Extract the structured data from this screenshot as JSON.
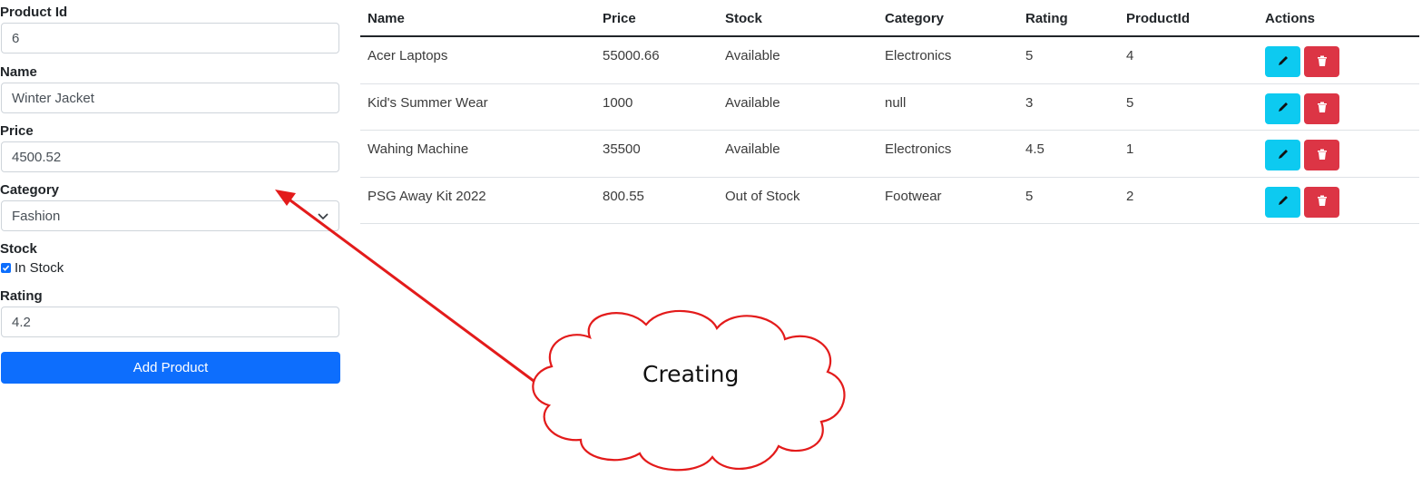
{
  "form": {
    "product_id": {
      "label": "Product Id",
      "value": "6"
    },
    "name": {
      "label": "Name",
      "value": "Winter Jacket"
    },
    "price": {
      "label": "Price",
      "value": "4500.52"
    },
    "category": {
      "label": "Category",
      "value": "Fashion"
    },
    "stock": {
      "label": "Stock",
      "checkbox_label": "In Stock",
      "checked": true
    },
    "rating": {
      "label": "Rating",
      "value": "4.2"
    },
    "submit_label": "Add Product"
  },
  "table": {
    "headers": [
      "Name",
      "Price",
      "Stock",
      "Category",
      "Rating",
      "ProductId",
      "Actions"
    ],
    "rows": [
      {
        "name": "Acer Laptops",
        "price": "55000.66",
        "stock": "Available",
        "category": "Electronics",
        "rating": "5",
        "product_id": "4"
      },
      {
        "name": "Kid's Summer Wear",
        "price": "1000",
        "stock": "Available",
        "category": "null",
        "rating": "3",
        "product_id": "5"
      },
      {
        "name": "Wahing Machine",
        "price": "35500",
        "stock": "Available",
        "category": "Electronics",
        "rating": "4.5",
        "product_id": "1"
      },
      {
        "name": "PSG Away Kit 2022",
        "price": "800.55",
        "stock": "Out of Stock",
        "category": "Footwear",
        "rating": "5",
        "product_id": "2"
      }
    ],
    "action_icons": {
      "edit": "pencil-icon",
      "delete": "trash-icon"
    }
  },
  "annotation": {
    "text": "Creating",
    "color": "#e31b1b"
  },
  "colors": {
    "primary": "#0d6efd",
    "info": "#0dcaf0",
    "danger": "#dc3545"
  }
}
